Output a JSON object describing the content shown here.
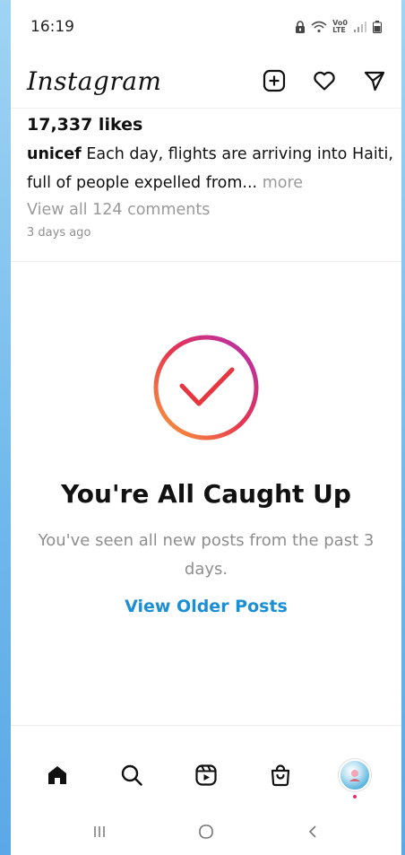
{
  "status_bar": {
    "time": "16:19",
    "icons": [
      "lock-icon",
      "wifi-icon",
      "volte-icon",
      "signal-icon",
      "battery-icon"
    ],
    "volte_text": "Vo0\nLTE"
  },
  "header": {
    "logo_text": "Instagram",
    "actions": [
      "new-post-icon",
      "heart-icon",
      "direct-message-icon"
    ]
  },
  "post": {
    "likes": "17,337 likes",
    "username": "unicef",
    "caption": " Each day, flights are arriving into Haiti, full of people expelled from...",
    "more_label": " more",
    "view_comments": "View all 124 comments",
    "time_ago": "3 days ago"
  },
  "caught_up": {
    "title": "You're All Caught Up",
    "subtitle": "You've seen all new posts from the past 3 days.",
    "link": "View Older Posts"
  },
  "bottom_nav": {
    "items": [
      "home-icon",
      "search-icon",
      "reels-icon",
      "shop-icon",
      "profile-avatar"
    ]
  },
  "system_nav": {
    "items": [
      "recent-apps-button",
      "home-button",
      "back-button"
    ]
  },
  "colors": {
    "link_blue": "#1a8fd6",
    "gradient_start": "#f7a23b",
    "gradient_mid": "#e8344f",
    "gradient_end": "#b12fb5",
    "check_red": "#e7363f"
  }
}
